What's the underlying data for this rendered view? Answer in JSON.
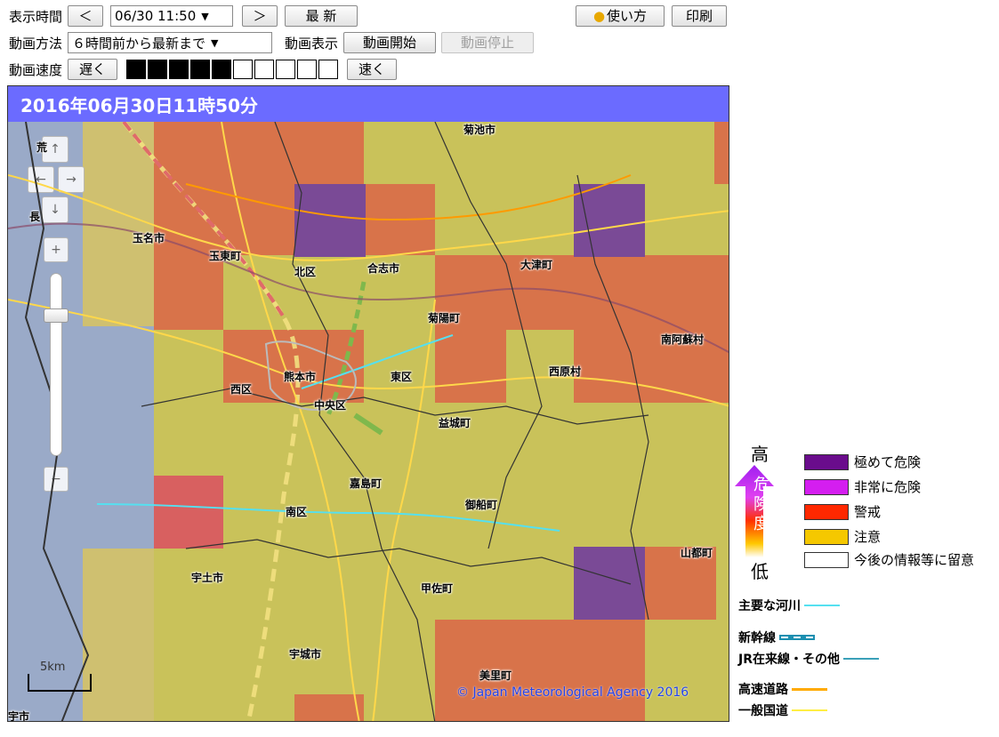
{
  "controls": {
    "row1": {
      "label": "表示時間",
      "prev": "＜",
      "time_value": "06/30 11:50",
      "next": "＞",
      "latest": "最 新",
      "howto": "使い方",
      "print": "印刷"
    },
    "row2": {
      "label": "動画方法",
      "method_value": "６時間前から最新まで",
      "display_label": "動画表示",
      "start": "動画開始",
      "stop": "動画停止"
    },
    "row3": {
      "label": "動画速度",
      "slow": "遅く",
      "fast": "速く",
      "speed_level": 5,
      "speed_max": 10
    }
  },
  "map": {
    "title": "2016年06月30日11時50分",
    "copyright": "© Japan Meteorological Agency 2016",
    "scale_label": "5km",
    "zoom_up": "↑",
    "zoom_left": "←",
    "zoom_right": "→",
    "zoom_down": "↓",
    "zoom_in": "+",
    "zoom_out": "−",
    "places": [
      "菊池市",
      "玉名市",
      "玉東町",
      "北区",
      "合志市",
      "大津町",
      "菊陽町",
      "南阿蘇村",
      "熊本市",
      "西区",
      "東区",
      "西原村",
      "中央区",
      "益城町",
      "嘉島町",
      "御船町",
      "南区",
      "山都町",
      "宇土市",
      "甲佐町",
      "宇城市",
      "美里町",
      "長",
      "荒",
      "宇市"
    ]
  },
  "legend": {
    "high": "高",
    "low": "低",
    "arrow_text": [
      "危",
      "険",
      "度"
    ],
    "items": [
      {
        "label": "極めて危険",
        "color": "#6a0c8c"
      },
      {
        "label": "非常に危険",
        "color": "#d41ef0"
      },
      {
        "label": "警戒",
        "color": "#ff2800"
      },
      {
        "label": "注意",
        "color": "#f5c800"
      },
      {
        "label": "今後の情報等に留意",
        "color": "#ffffff"
      }
    ],
    "lines": [
      {
        "label": "主要な河川",
        "color": "#55e0f0"
      },
      {
        "label": "新幹線",
        "color": "#1c8fb0"
      },
      {
        "label": "JR在来線・その他",
        "color": "#3aa0b8"
      },
      {
        "label": "高速道路",
        "color": "#ffaa00"
      },
      {
        "label": "一般国道",
        "color": "#ffee44"
      }
    ]
  }
}
